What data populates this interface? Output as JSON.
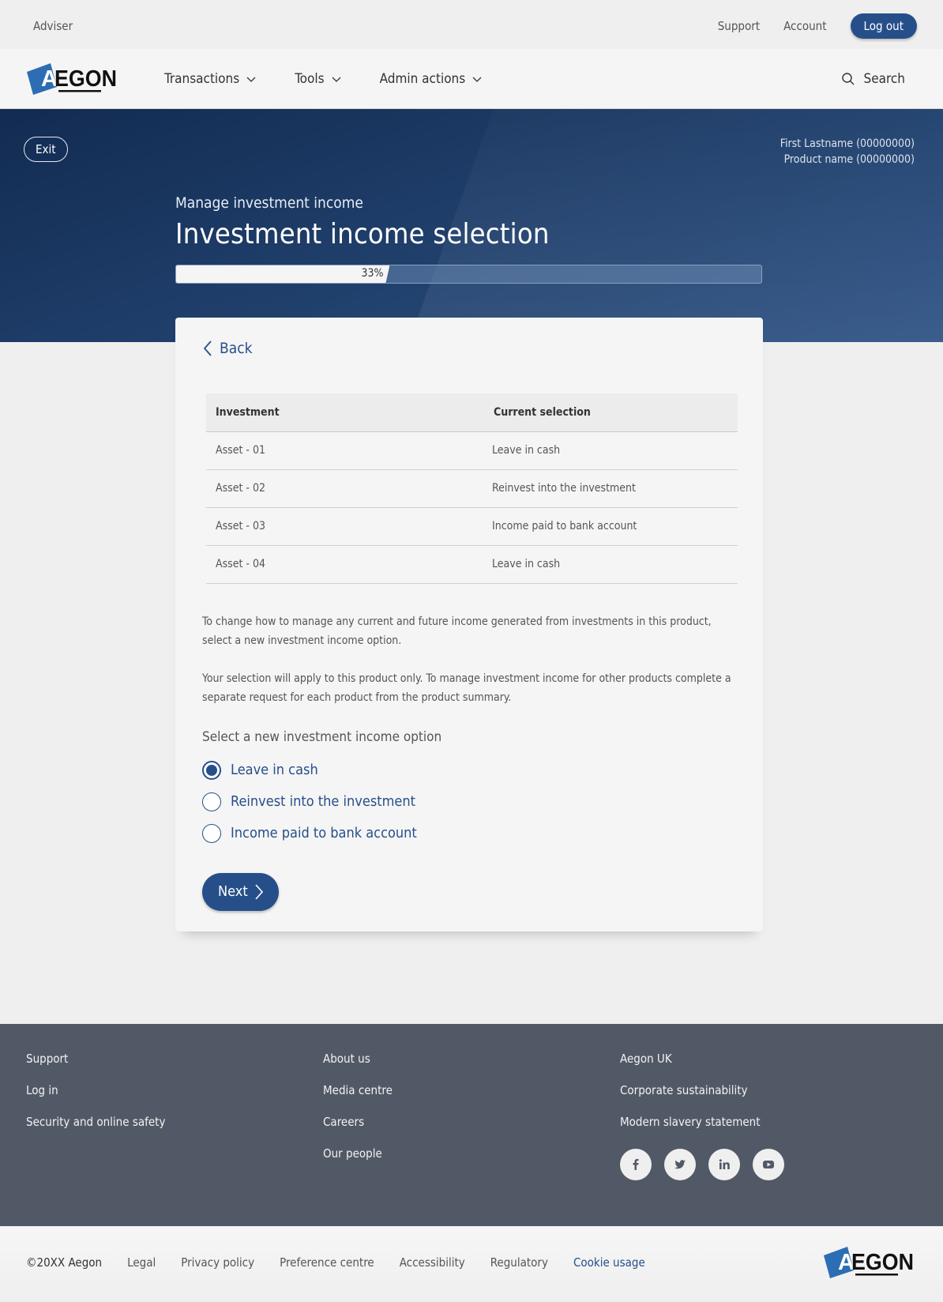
{
  "utility_bar": {
    "role": "Adviser",
    "links": [
      "Support",
      "Account"
    ],
    "logout_label": "Log out"
  },
  "brand": {
    "name": "AEGON",
    "colors": {
      "primary": "#264f8a",
      "logo_blue": "#2d6db3",
      "footer_bg": "#525966"
    }
  },
  "nav": {
    "items": [
      {
        "label": "Transactions",
        "icon": "chevron-down-icon"
      },
      {
        "label": "Tools",
        "icon": "chevron-down-icon"
      },
      {
        "label": "Admin actions",
        "icon": "chevron-down-icon"
      }
    ],
    "search_label": "Search"
  },
  "hero": {
    "exit_label": "Exit",
    "customer_name": "First Lastname (00000000)",
    "product_name": "Product name (00000000)",
    "subtitle": "Manage investment income",
    "title": "Investment income selection",
    "progress": {
      "percent": 33,
      "label": "33%"
    }
  },
  "card": {
    "back_label": "Back",
    "table": {
      "headers": [
        "Investment",
        "Current selection"
      ],
      "rows": [
        {
          "investment": "Asset  - 01",
          "selection": "Leave in cash"
        },
        {
          "investment": "Asset  - 02",
          "selection": "Reinvest into the investment"
        },
        {
          "investment": "Asset  - 03",
          "selection": "Income paid to bank account"
        },
        {
          "investment": "Asset  - 04",
          "selection": "Leave in cash"
        }
      ]
    },
    "paragraphs": [
      "To change how to manage any current and future income generated from investments in this product, select a new investment income option.",
      "Your selection will apply to this product only. To manage investment income for other products complete a separate request for each product from the product summary."
    ],
    "options_label": "Select a new investment income option",
    "options": [
      {
        "label": "Leave in cash",
        "checked": true
      },
      {
        "label": "Reinvest into the investment",
        "checked": false
      },
      {
        "label": "Income paid to bank account",
        "checked": false
      }
    ],
    "next_label": "Next"
  },
  "footer": {
    "columns": [
      [
        "Support",
        "Log in",
        "Security and online safety"
      ],
      [
        "About us",
        "Media centre",
        "Careers",
        "Our people"
      ],
      [
        "Aegon UK",
        "Corporate sustainability",
        "Modern slavery statement"
      ]
    ],
    "social": [
      "facebook-icon",
      "twitter-icon",
      "linkedin-icon",
      "youtube-icon"
    ]
  },
  "sub_footer": {
    "copyright": "©20XX Aegon",
    "links": [
      "Legal",
      "Privacy policy",
      "Preference centre",
      "Accessibility",
      "Regulatory",
      "Cookie usage"
    ]
  }
}
